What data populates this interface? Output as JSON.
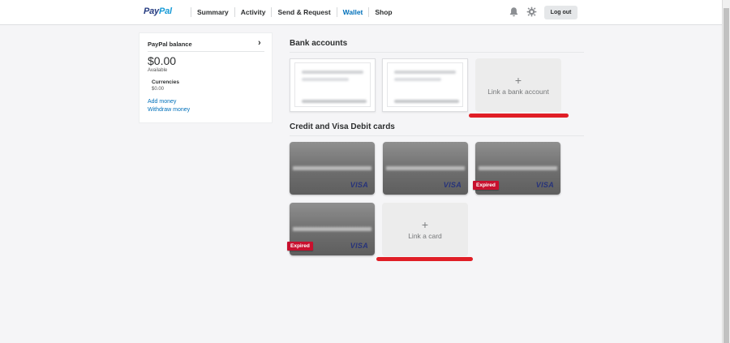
{
  "header": {
    "logo_pay": "Pay",
    "logo_pal": "Pal",
    "nav": [
      "Summary",
      "Activity",
      "Send & Request",
      "Wallet",
      "Shop"
    ],
    "active_nav": "Wallet",
    "logout_label": "Log out",
    "icons": [
      "bell-icon",
      "gear-icon"
    ]
  },
  "balance": {
    "title": "PayPal balance",
    "amount": "$0.00",
    "available_label": "Available",
    "currencies_label": "Currencies",
    "currency_amount": "$0.00",
    "add_money": "Add money",
    "withdraw_money": "Withdraw money"
  },
  "bank_section": {
    "title": "Bank accounts",
    "link_label": "Link a bank account",
    "plus": "+"
  },
  "cards_section": {
    "title": "Credit and Visa Debit cards",
    "link_label": "Link a card",
    "plus": "+",
    "cards": [
      {
        "brand": "VISA",
        "expired": false
      },
      {
        "brand": "VISA",
        "expired": false
      },
      {
        "brand": "VISA",
        "expired": true,
        "expired_label": "Expired"
      },
      {
        "brand": "VISA",
        "expired": true,
        "expired_label": "Expired"
      }
    ]
  },
  "colors": {
    "accent": "#0070ba",
    "highlight_underline": "#e01e26",
    "expired_badge": "#c8102e"
  }
}
